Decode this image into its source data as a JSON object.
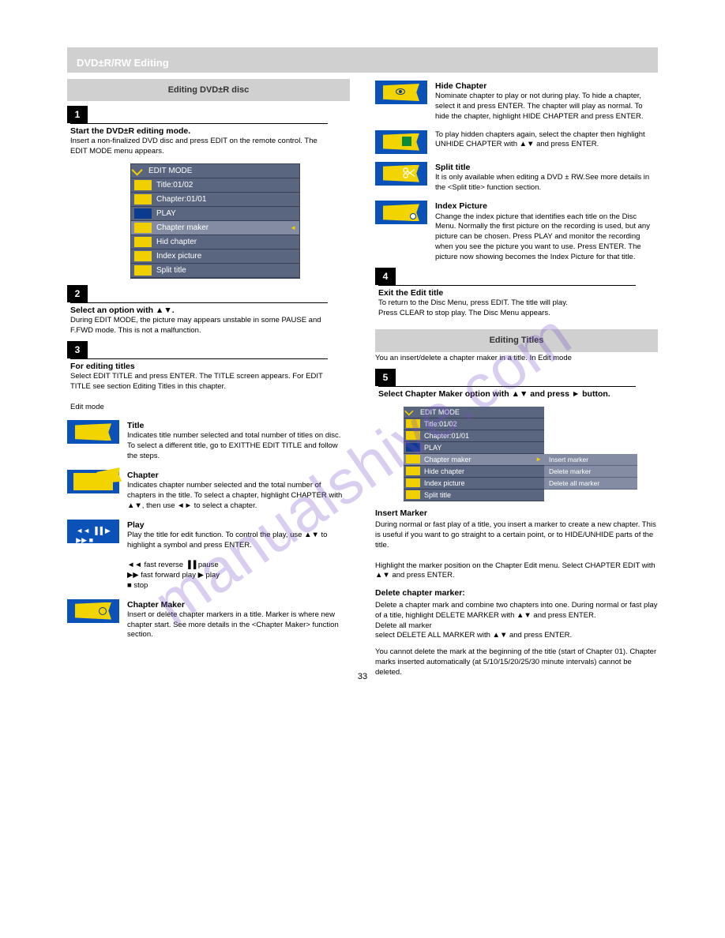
{
  "page": {
    "title_bar": "DVD±R/RW Editing",
    "page_number": "33"
  },
  "watermark": "manualshive.com",
  "left": {
    "subheader": "Editing DVD±R disc",
    "step1": {
      "head": "Start the DVD±R editing mode.",
      "text": "Insert a non-finalized DVD disc and press EDIT on the remote control. The EDIT MODE menu appears."
    },
    "menu1": {
      "header": "EDIT MODE",
      "items": [
        {
          "label": "Title:01/02"
        },
        {
          "label": "Chapter:01/01"
        },
        {
          "label": "PLAY"
        },
        {
          "label": "Chapter maker",
          "selected": true
        },
        {
          "label": "Hid   chapter"
        },
        {
          "label": "Index picture"
        },
        {
          "label": "Split title"
        }
      ]
    },
    "step2": {
      "head": "Select an option with ▲▼.",
      "text": "During EDIT MODE, the picture may appears unstable in some PAUSE and F.FWD mode. This is not a malfunction."
    },
    "step3": {
      "head": "For editing titles",
      "text": "Select EDIT TITLE and press ENTER. The TITLE screen appears. For EDIT TITLE see section Editing Titles in this chapter.\n\nEdit mode"
    },
    "icons": {
      "title": {
        "head": "Title",
        "text": "Indicates title number selected and total number of titles on disc. To select a different title, go to EXITTHE EDIT TITLE and follow the steps."
      },
      "chapter": {
        "head": "Chapter",
        "text": "Indicates chapter number selected and the total number of chapters in the title. To select a chapter, highlight CHAPTER with ▲▼, then use ◄► to select a chapter."
      },
      "play": {
        "head": "Play",
        "text": "Play the title for edit function. To control the play, use ▲▼ to highlight a symbol and press ENTER.\n\n◄◄  fast reverse            ▐▐  pause\n▶▶  fast forward play  ▶  play\n■  stop"
      },
      "chapter_maker": {
        "head": "Chapter Maker",
        "text": "Insert or delete chapter markers in a title. Marker is where new chapter start. See more details in the <Chapter Maker> function section."
      }
    }
  },
  "right": {
    "icons": {
      "hide": {
        "head": "Hide Chapter",
        "text": "Nominate chapter to play or not during play. To hide a chapter, select it and press ENTER. The chapter will play as normal. To hide the chapter, highlight HIDE CHAPTER and press ENTER."
      },
      "unhide": {
        "head": "",
        "text": "To play hidden chapters again, select the chapter then highlight UNHIDE CHAPTER with ▲▼ and press ENTER."
      },
      "split": {
        "head": "Split title",
        "text": "It is only available when editing a DVD ± RW.See more details in the <Split title> function section."
      },
      "index": {
        "head": "Index Picture",
        "text": "Change the index picture that identifies each title on the Disc Menu. Normally the first picture on the recording is used, but any picture can be chosen. Press PLAY and monitor the recording when you see the picture you want to use. Press ENTER. The picture now showing becomes the Index Picture for that title."
      }
    },
    "step4": {
      "head": "Exit the Edit title",
      "text": "To return to the Disc Menu, press EDIT. The title will play.\nPress CLEAR to stop play. The Disc Menu appears."
    },
    "subheader": "Editing Titles",
    "subheader_text": "You an insert/delete a chapter maker in a title. In Edit mode",
    "step5": {
      "head": "Select Chapter Maker option with ▲▼ and press ► button.",
      "text": ""
    },
    "menu2": {
      "header": "EDIT MODE",
      "items": [
        {
          "label": "Title:01/02"
        },
        {
          "label": "Chapter:01/01"
        },
        {
          "label": "PLAY"
        },
        {
          "label": "Chapter maker",
          "selected": true
        },
        {
          "label": "Hide chapter"
        },
        {
          "label": "Index picture"
        },
        {
          "label": "Split title"
        }
      ],
      "submenu": [
        "Insert marker",
        "Delete marker",
        "Delete all marker"
      ]
    },
    "insert": {
      "head": "Insert Marker",
      "text": "During normal or fast play of a title, you insert a marker to create a new chapter. This is useful if you want to go straight to a certain point, or to HIDE/UNHIDE parts of the title.\n\nHighlight the marker position on the Chapter Edit menu. Select CHAPTER EDIT with ▲▼ and press ENTER."
    },
    "delete": {
      "head": "Delete chapter marker:",
      "text": "Delete a chapter mark and combine two chapters into one. During normal or fast play of a title, highlight DELETE MARKER with ▲▼ and press ENTER.\nDelete all marker\nselect DELETE ALL MARKER with ▲▼ and press ENTER."
    },
    "note": "You cannot delete the mark at the beginning of the title (start of Chapter 01). Chapter marks inserted automatically (at 5/10/15/20/25/30 minute intervals) cannot be deleted."
  }
}
